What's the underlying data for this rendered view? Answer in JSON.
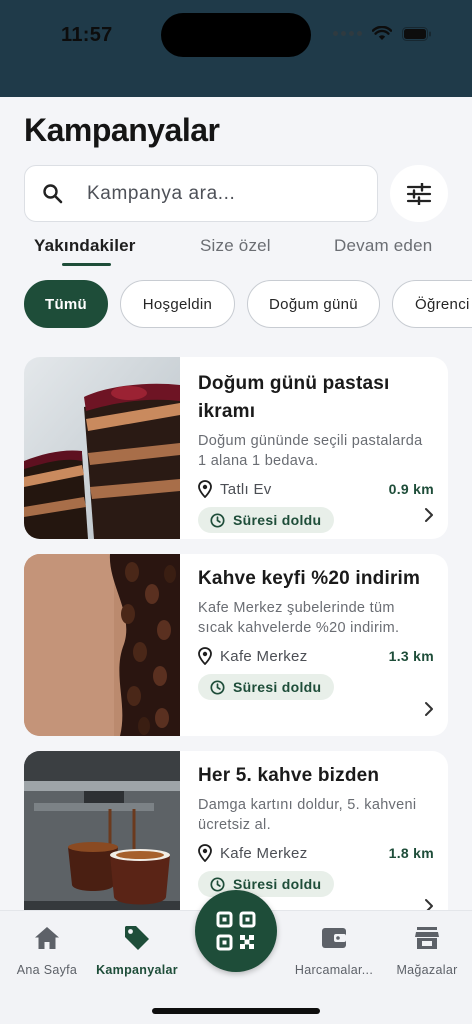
{
  "status_bar": {
    "time": "11:57"
  },
  "page": {
    "title": "Kampanyalar"
  },
  "search": {
    "placeholder": "Kampanya ara..."
  },
  "tabs": [
    {
      "label": "Yakındakiler",
      "active": true
    },
    {
      "label": "Size özel",
      "active": false
    },
    {
      "label": "Devam eden",
      "active": false
    }
  ],
  "chips": [
    {
      "label": "Tümü",
      "active": true
    },
    {
      "label": "Hoşgeldin",
      "active": false
    },
    {
      "label": "Doğum günü",
      "active": false
    },
    {
      "label": "Öğrenci",
      "active": false
    }
  ],
  "campaigns": [
    {
      "title": "Doğum günü pastası ikramı",
      "description": "Doğum gününde seçili pastalarda 1 alana 1 bedava.",
      "store": "Tatlı Ev",
      "distance": "0.9 km",
      "status": "Süresi doldu",
      "image": "cake-photo"
    },
    {
      "title": "Kahve keyfi %20 indirim",
      "description": "Kafe Merkez şubelerinde tüm sıcak kahvelerde %20 indirim.",
      "store": "Kafe Merkez",
      "distance": "1.3 km",
      "status": "Süresi doldu",
      "image": "coffee-beans-photo"
    },
    {
      "title": "Her 5. kahve bizden",
      "description": "Damga kartını doldur, 5. kahveni ücretsiz al.",
      "store": "Kafe Merkez",
      "distance": "1.8 km",
      "status": "Süresi doldu",
      "image": "espresso-machine-photo"
    }
  ],
  "bottom_nav": {
    "items": [
      {
        "label": "Ana Sayfa",
        "icon": "home-icon"
      },
      {
        "label": "Kampanyalar",
        "icon": "tag-icon",
        "active": true
      },
      {
        "label": "Harcamalar...",
        "icon": "wallet-icon"
      },
      {
        "label": "Mağazalar",
        "icon": "store-icon"
      }
    ],
    "center_icon": "qr-code-icon"
  },
  "colors": {
    "accent": "#1e4d39",
    "header_band": "#1f3a49",
    "background": "#f4f5f8",
    "badge_bg": "#e8efe9"
  }
}
